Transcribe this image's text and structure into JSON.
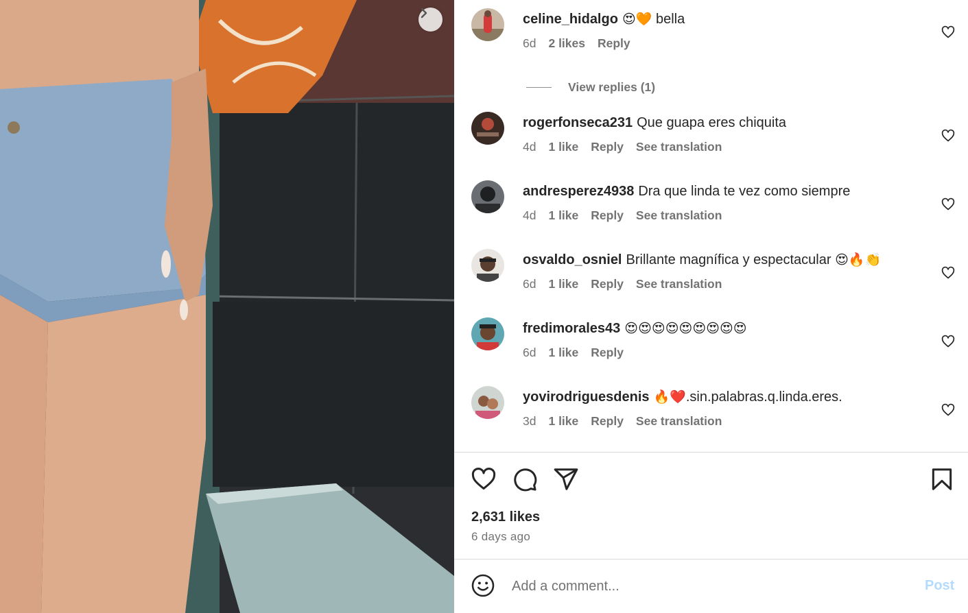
{
  "photo": {
    "next_icon": "chevron-right-icon"
  },
  "comments": [
    {
      "username": "celine_hidalgo",
      "text": " bella",
      "emojis": "😍🧡",
      "time": "6d",
      "likes": "2 likes",
      "reply": "Reply",
      "translate": "",
      "view_replies": "View replies (1)"
    },
    {
      "username": "rogerfonseca231",
      "text": "Que guapa eres chiquita",
      "emojis": "",
      "time": "4d",
      "likes": "1 like",
      "reply": "Reply",
      "translate": "See translation"
    },
    {
      "username": "andresperez4938",
      "text": "Dra que linda te vez como siempre",
      "emojis": "",
      "time": "4d",
      "likes": "1 like",
      "reply": "Reply",
      "translate": "See translation"
    },
    {
      "username": "osvaldo_osniel",
      "text": "Brillante magnífica y espectacular ",
      "emojis": "😍🔥👏",
      "time": "6d",
      "likes": "1 like",
      "reply": "Reply",
      "translate": "See translation"
    },
    {
      "username": "fredimorales43",
      "text": "",
      "emojis": "😍😍😍😍😍😍😍😍😍",
      "time": "6d",
      "likes": "1 like",
      "reply": "Reply",
      "translate": ""
    },
    {
      "username": "yovirodriguesdenis",
      "text": ".sin.palabras.q.linda.eres.",
      "emojis": "🔥❤️",
      "time": "3d",
      "likes": "1 like",
      "reply": "Reply",
      "translate": "See translation"
    }
  ],
  "actions": {
    "like_icon": "heart-icon",
    "comment_icon": "comment-bubble-icon",
    "share_icon": "paper-plane-icon",
    "save_icon": "bookmark-icon"
  },
  "post": {
    "likes": "2,631 likes",
    "time": "6 days ago"
  },
  "composer": {
    "emoji_icon": "smiley-icon",
    "placeholder": "Add a comment...",
    "post_label": "Post",
    "post_color": "#b3dbff"
  }
}
